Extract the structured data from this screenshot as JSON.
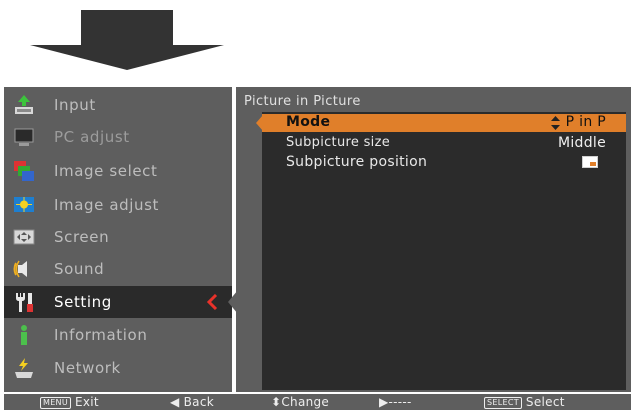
{
  "menu": {
    "items": [
      {
        "label": "Input",
        "icon": "input-icon",
        "state": "normal"
      },
      {
        "label": "PC adjust",
        "icon": "monitor-icon",
        "state": "dim"
      },
      {
        "label": "Image select",
        "icon": "image-select-icon",
        "state": "normal"
      },
      {
        "label": "Image adjust",
        "icon": "image-adjust-icon",
        "state": "normal"
      },
      {
        "label": "Screen",
        "icon": "screen-icon",
        "state": "normal"
      },
      {
        "label": "Sound",
        "icon": "speaker-icon",
        "state": "normal"
      },
      {
        "label": "Setting",
        "icon": "tools-icon",
        "state": "selected"
      },
      {
        "label": "Information",
        "icon": "info-icon",
        "state": "normal"
      },
      {
        "label": "Network",
        "icon": "network-icon",
        "state": "normal"
      }
    ]
  },
  "panel": {
    "title": "Picture in Picture",
    "rows": [
      {
        "label": "Mode",
        "value": "P in P"
      },
      {
        "label": "Subpicture size",
        "value": "Middle"
      },
      {
        "label": "Subpicture position",
        "value": ""
      }
    ]
  },
  "footer": {
    "exit_key": "MENU",
    "exit": "Exit",
    "back": "◀ Back",
    "change": "⬍Change",
    "next": "▶-----",
    "select_key": "SELECT",
    "select": "Select"
  },
  "colors": {
    "accent": "#e07f2a",
    "panel": "#5e5e5e",
    "inner": "#2b2b2b",
    "selected_arrow": "#e8322a"
  }
}
